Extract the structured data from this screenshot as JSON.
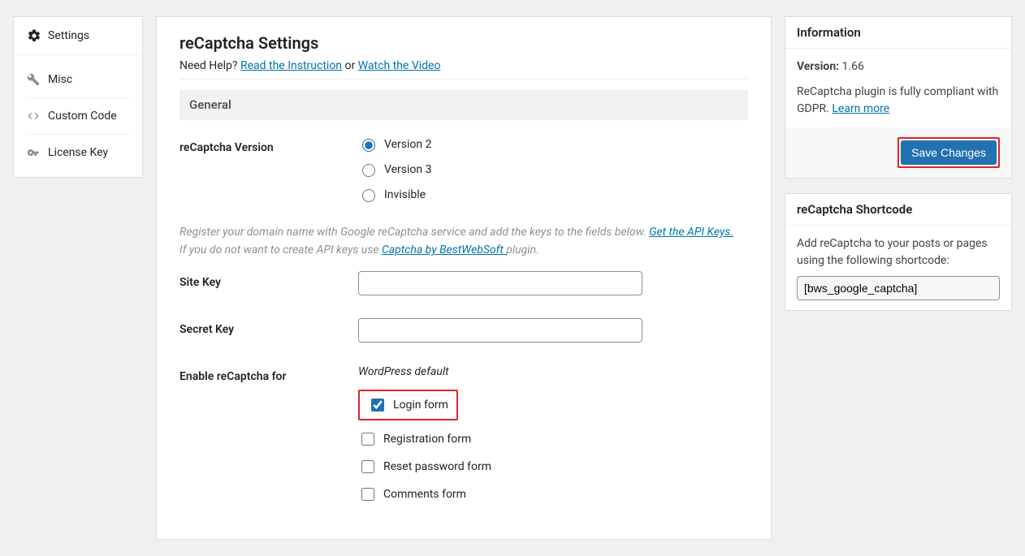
{
  "sidebar": {
    "title": "Settings",
    "items": [
      {
        "label": "Misc",
        "icon": "wrench-icon"
      },
      {
        "label": "Custom Code",
        "icon": "code-icon"
      },
      {
        "label": "License Key",
        "icon": "key-icon"
      }
    ]
  },
  "page": {
    "title": "reCaptcha Settings",
    "help_prefix": "Need Help? ",
    "help_link1": "Read the Instruction",
    "help_or": " or ",
    "help_link2": "Watch the Video"
  },
  "general": {
    "heading": "General",
    "version_label": "reCaptcha Version",
    "version_options": [
      "Version 2",
      "Version 3",
      "Invisible"
    ],
    "version_selected": 0,
    "register_note1": "Register your domain name with Google reCaptcha service and add the keys to the fields below. ",
    "register_link": "Get the API Keys.",
    "register_note2": "If you do not want to create API keys use ",
    "register_link2": "Captcha by BestWebSoft ",
    "register_note3": "plugin.",
    "site_key_label": "Site Key",
    "secret_key_label": "Secret Key",
    "enable_label": "Enable reCaptcha for",
    "enable_subhead": "WordPress default",
    "enable_options": [
      {
        "label": "Login form",
        "checked": true,
        "highlighted": true
      },
      {
        "label": "Registration form",
        "checked": false
      },
      {
        "label": "Reset password form",
        "checked": false
      },
      {
        "label": "Comments form",
        "checked": false
      }
    ]
  },
  "sidebar_right": {
    "info_title": "Information",
    "version_label": "Version:",
    "version_value": "1.66",
    "gdpr_text": "ReCaptcha plugin is fully compliant with GDPR. ",
    "gdpr_link": "Learn more",
    "save_button": "Save Changes",
    "shortcode_title": "reCaptcha Shortcode",
    "shortcode_text": "Add reCaptcha to your posts or pages using the following shortcode:",
    "shortcode_value": "[bws_google_captcha]"
  }
}
